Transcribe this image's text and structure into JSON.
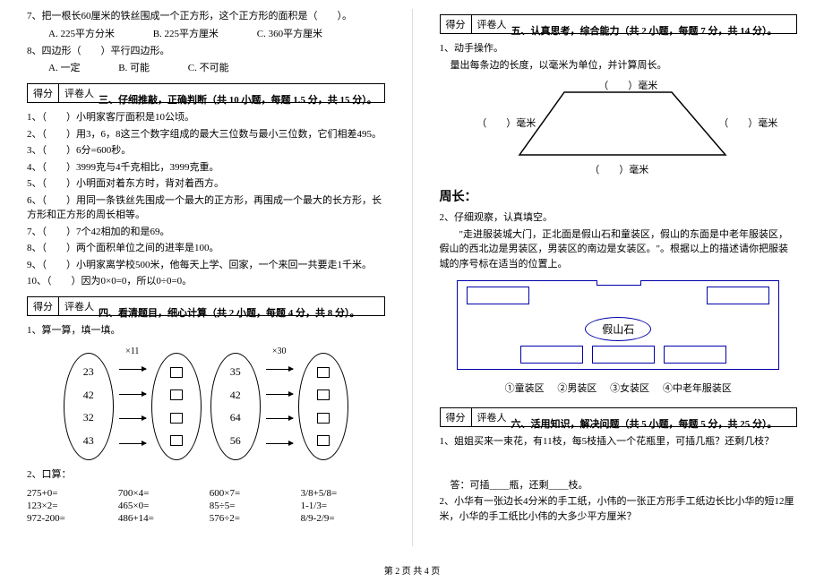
{
  "left": {
    "q7": "7、把一根长60厘米的铁丝围成一个正方形，这个正方形的面积是（　　）。",
    "q7_opts": {
      "a": "A. 225平方分米",
      "b": "B. 225平方厘米",
      "c": "C. 360平方厘米"
    },
    "q8": "8、四边形（　　）平行四边形。",
    "q8_opts": {
      "a": "A. 一定",
      "b": "B. 可能",
      "c": "C. 不可能"
    },
    "score_labels": {
      "score": "得分",
      "reviewer": "评卷人"
    },
    "section3": "三、仔细推敲，正确判断（共 10 小题，每题 1.5 分，共 15 分）。",
    "s3": {
      "q1": "1、（　　）小明家客厅面积是10公顷。",
      "q2": "2、（　　）用3，6，8这三个数字组成的最大三位数与最小三位数，它们相差495。",
      "q3": "3、（　　）6分=600秒。",
      "q4": "4、（　　）3999克与4千克相比，3999克重。",
      "q5": "5、（　　）小明面对着东方时，背对着西方。",
      "q6": "6、（　　）用同一条铁丝先围成一个最大的正方形，再围成一个最大的长方形，长方形和正方形的周长相等。",
      "q7": "7、（　　）7个42相加的和是69。",
      "q8": "8、（　　）两个面积单位之间的进率是100。",
      "q9": "9、（　　）小明家离学校500米，他每天上学、回家，一个来回一共要走1千米。",
      "q10": "10、（　　）因为0×0=0，所以0÷0=0。"
    },
    "section4": "四、看清题目，细心计算（共 2 小题，每题 4 分，共 8 分）。",
    "s4_q1": "1、算一算，填一填。",
    "flow": {
      "mult1": "×11",
      "mult2": "×30",
      "set1": [
        "23",
        "42",
        "32",
        "43"
      ],
      "set2": [
        "35",
        "42",
        "64",
        "56"
      ]
    },
    "s4_q2": "2、口算：",
    "mental": [
      "275+0=",
      "700×4=",
      "600×7=",
      "3/8+5/8=",
      "123×2=",
      "465×0=",
      "85÷5=",
      "1-1/3=",
      "972-200=",
      "486+14=",
      "576÷2=",
      "8/9-2/9="
    ]
  },
  "right": {
    "score_labels": {
      "score": "得分",
      "reviewer": "评卷人"
    },
    "section5": "五、认真思考，综合能力（共 2 小题，每题 7 分，共 14 分）。",
    "s5_q1": "1、动手操作。",
    "s5_q1_desc": "量出每条边的长度，以毫米为单位，并计算周长。",
    "mm_label": "）毫米",
    "paren": "（",
    "perimeter": "周长：",
    "s5_q2": "2、仔细观察，认真填空。",
    "s5_q2_desc": "　　\"走进服装城大门，正北面是假山石和童装区，假山的东面是中老年服装区，假山的西北边是男装区，男装区的南边是女装区。\"。根据以上的描述请你把服装城的序号标在适当的位置上。",
    "rockery": "假山石",
    "legend": {
      "a": "①童装区",
      "b": "②男装区",
      "c": "③女装区",
      "d": "④中老年服装区"
    },
    "section6": "六、活用知识，解决问题（共 5 小题，每题 5 分，共 25 分）。",
    "s6_q1": "1、姐姐买来一束花，有11枝，每5枝插入一个花瓶里，可插几瓶？还剩几枝？",
    "s6_q1_ans": "答：可插____瓶，还剩____枝。",
    "s6_q2": "2、小华有一张边长4分米的手工纸，小伟的一张正方形手工纸边长比小华的短12厘米，小华的手工纸比小伟的大多少平方厘米？"
  },
  "footer": "第 2 页 共 4 页"
}
